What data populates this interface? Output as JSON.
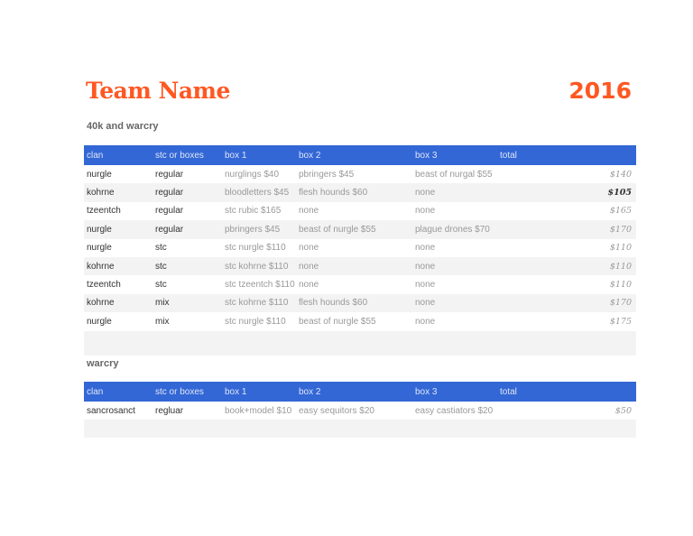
{
  "header": {
    "title": "Team Name",
    "year": "2016"
  },
  "columns": [
    "clan",
    "stc or boxes",
    "box 1",
    "box 2",
    "box 3",
    "total"
  ],
  "sections": [
    {
      "title": "40k and warcry",
      "rows": [
        [
          "nurgle",
          "regular",
          "nurglings $40",
          "pbringers $45",
          "beast of nurgal $55",
          "$140"
        ],
        [
          "kohrne",
          "regular",
          "bloodletters $45",
          "flesh hounds $60",
          "none",
          "$105"
        ],
        [
          "tzeentch",
          "regular",
          "stc rubic $165",
          "none",
          "none",
          "$165"
        ],
        [
          "nurgle",
          "regular",
          "pbringers $45",
          "beast of nurgle $55",
          "plague drones $70",
          "$170"
        ],
        [
          "nurgle",
          "stc",
          "stc nurgle $110",
          "none",
          "none",
          "$110"
        ],
        [
          "kohrne",
          "stc",
          "stc kohrne $110",
          "none",
          "none",
          "$110"
        ],
        [
          "tzeentch",
          "stc",
          "stc tzeentch $110",
          "none",
          "none",
          "$110"
        ],
        [
          "kohrne",
          "mix",
          "stc kohrne $110",
          "flesh hounds $60",
          "none",
          "$170"
        ],
        [
          "nurgle",
          "mix",
          "stc nurgle $110",
          "beast of nurgle $55",
          "none",
          "$175"
        ]
      ]
    },
    {
      "title": "warcry",
      "rows": [
        [
          "sancrosanct",
          "regluar",
          "book+model $10",
          "easy sequitors $20",
          "easy castiators $20",
          "$50"
        ]
      ]
    }
  ]
}
